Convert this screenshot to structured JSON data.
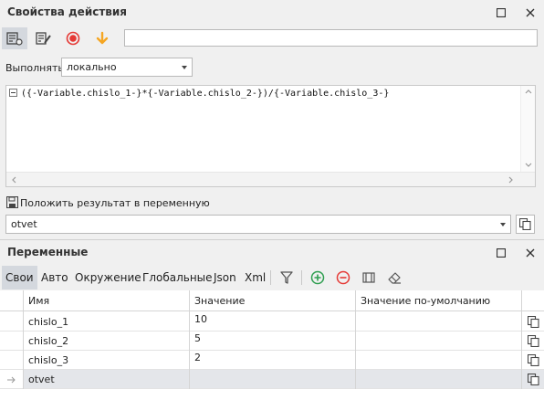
{
  "action_panel": {
    "title": "Свойства действия",
    "execute_label": "Выполнять",
    "execute_value": "локально",
    "code": "({-Variable.chislo_1-}*{-Variable.chislo_2-})/{-Variable.chislo_3-}",
    "save_result_label": "Положить результат в переменную",
    "result_variable": "otvet"
  },
  "variables_panel": {
    "title": "Переменные",
    "tabs": [
      "Свои",
      "Авто",
      "Окружение",
      "Глобальные",
      "Json",
      "Xml"
    ],
    "columns": [
      "Имя",
      "Значение",
      "Значение по-умолчанию"
    ],
    "rows": [
      {
        "name": "chislo_1",
        "value": "10",
        "default": ""
      },
      {
        "name": "chislo_2",
        "value": "5",
        "default": ""
      },
      {
        "name": "chislo_3",
        "value": "2",
        "default": ""
      },
      {
        "name": "otvet",
        "value": "",
        "default": ""
      }
    ]
  },
  "colors": {
    "record": "#e53935",
    "arrow": "#f5a623",
    "add": "#2e9e4f",
    "remove": "#e53935"
  }
}
